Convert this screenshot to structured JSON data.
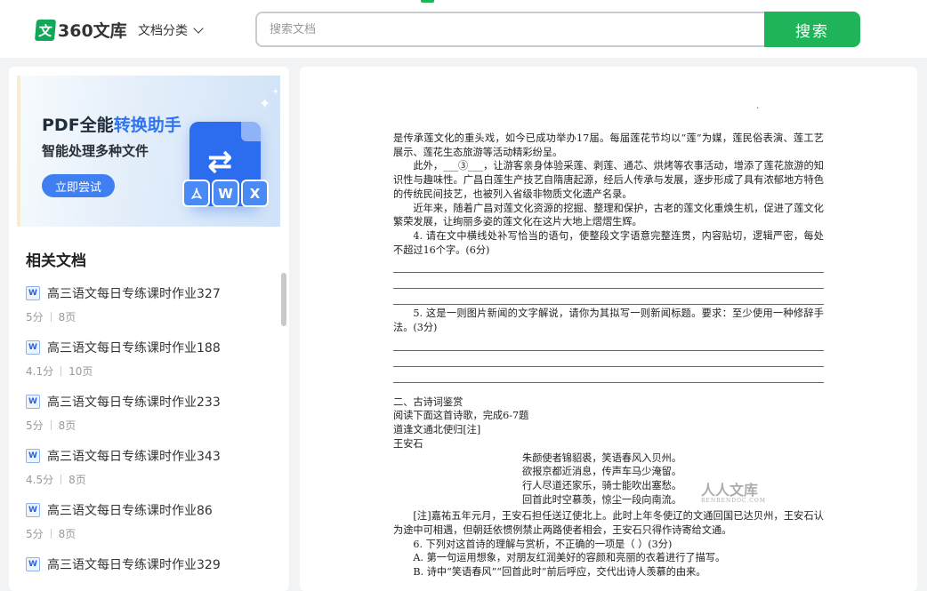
{
  "header": {
    "logo_badge": "文",
    "logo_text": "360文库",
    "category_label": "文档分类",
    "search_placeholder": "搜索文档",
    "search_button": "搜索"
  },
  "banner": {
    "title_prefix": "PDF全能",
    "title_highlight": "转换助手",
    "subtitle": "智能处理多种文件",
    "button": "立即尝试",
    "chip_w": "W",
    "chip_x": "X"
  },
  "related": {
    "title": "相关文档",
    "items": [
      {
        "title": "高三语文每日专练课时作业327",
        "score": "5分",
        "pages": "8页"
      },
      {
        "title": "高三语文每日专练课时作业188",
        "score": "4.1分",
        "pages": "10页"
      },
      {
        "title": "高三语文每日专练课时作业233",
        "score": "5分",
        "pages": "8页"
      },
      {
        "title": "高三语文每日专练课时作业343",
        "score": "4.5分",
        "pages": "8页"
      },
      {
        "title": "高三语文每日专练课时作业86",
        "score": "5分",
        "pages": "8页"
      },
      {
        "title": "高三语文每日专练课时作业329",
        "score": "",
        "pages": ""
      }
    ]
  },
  "document": {
    "p1": "是传承莲文化的重头戏，如今已成功举办17届。每届莲花节均以“莲”为媒，莲民俗表演、莲工艺展示、莲花生态旅游等活动精彩纷呈。",
    "p2": "此外，___③___，让游客亲身体验采莲、剥莲、通芯、烘烤等农事活动，增添了莲花旅游的知识性与趣味性。广昌白莲生产技艺自隋唐起源，经后人传承与发展，逐步形成了具有浓郁地方特色的传统民间技艺，也被列入省级非物质文化遗产名录。",
    "p3": "近年来，随着广昌对莲文化资源的挖掘、整理和保护，古老的莲文化重焕生机，促进了莲文化繁荣发展，让绚丽多姿的莲文化在这片大地上熠熠生辉。",
    "q4": "4. 请在文中横线处补写恰当的语句，使整段文字语意完整连贯，内容贴切，逻辑严密，每处不超过16个字。(6分)",
    "q5": "5. 这是一则图片新闻的文字解说，请你为其拟写一则新闻标题。要求：至少使用一种修辞手法。(3分)",
    "sec2": "二、古诗词鉴赏",
    "sec2_intro": "阅读下面这首诗歌，完成6-7题",
    "poem_title": "道逢文通北使归[注]",
    "poem_author": "王安石",
    "poem_lines": [
      "朱颜使者锦貂裘，笑语春风入贝州。",
      "欲报京都近消息，传声车马少淹留。",
      "行人尽道还家乐，骑士能吹出塞愁。",
      "回首此时空慕羡，惊尘一段向南流。"
    ],
    "note": "[注]嘉祐五年元月，王安石担任送辽使北上。此时上年冬使辽的文通回国已达贝州，王安石认为途中可相遇，但朝廷依惯例禁止两路使者相会，王安石只得作诗寄给文通。",
    "q6": "6. 下列对这首诗的理解与赏析，不正确的一项是（ ）(3分)",
    "q6a": "A. 第一句运用想象，对朋友红润美好的容颜和亮丽的衣着进行了描写。",
    "q6b": "B. 诗中“笑语春风”“回首此时”前后呼应，交代出诗人羡慕的由来。",
    "watermark": "人人文库",
    "watermark_sub": "RENRENDOC.COM"
  }
}
